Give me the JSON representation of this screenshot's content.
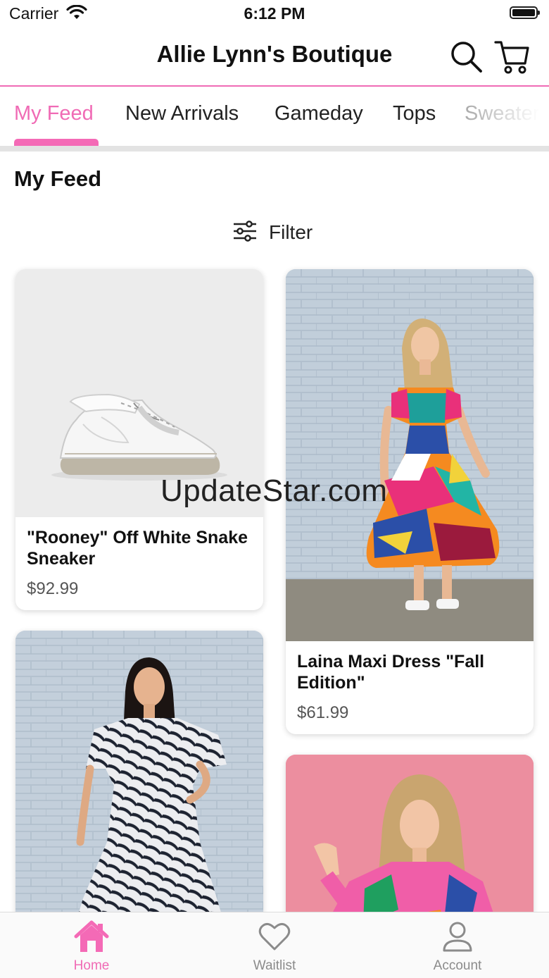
{
  "status_bar": {
    "carrier": "Carrier",
    "time": "6:12 PM"
  },
  "header": {
    "title": "Allie Lynn's Boutique",
    "search_icon": "search-icon",
    "cart_icon": "cart-icon"
  },
  "tabs": [
    {
      "label": "My Feed",
      "active": true
    },
    {
      "label": "New Arrivals",
      "active": false
    },
    {
      "label": "Gameday",
      "active": false
    },
    {
      "label": "Tops",
      "active": false
    },
    {
      "label": "Sweaters",
      "active": false
    }
  ],
  "feed": {
    "title": "My Feed",
    "filter_label": "Filter",
    "products": [
      {
        "name": "\"Rooney\" Off White Snake Sneaker",
        "price": "$92.99"
      },
      {
        "name": "Laina Maxi Dress \"Fall Edition\"",
        "price": "$61.99"
      },
      {
        "name": "",
        "price": ""
      },
      {
        "name": "",
        "price": ""
      }
    ]
  },
  "watermark": "UpdateStar.com",
  "bottom_nav": [
    {
      "label": "Home",
      "icon": "home-icon",
      "active": true
    },
    {
      "label": "Waitlist",
      "icon": "heart-icon",
      "active": false
    },
    {
      "label": "Account",
      "icon": "account-icon",
      "active": false
    }
  ],
  "colors": {
    "accent": "#f06bb5",
    "inactive": "#8b8b8b"
  }
}
